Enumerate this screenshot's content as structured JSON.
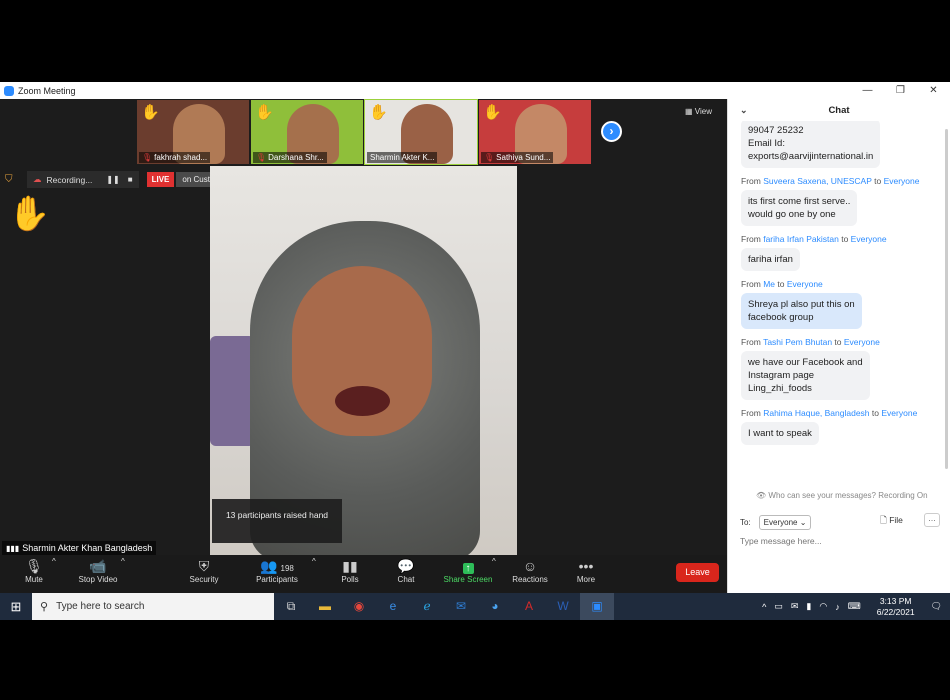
{
  "window": {
    "title": "Zoom Meeting",
    "controls": [
      "—",
      "❐",
      "✕"
    ]
  },
  "participants_strip": [
    {
      "name": "fakhrah shad...",
      "bg": "#6b3d2e",
      "face": "#b07a55",
      "hand": true,
      "muted": true
    },
    {
      "name": "Darshana Shr...",
      "bg": "#8fbf3a",
      "face": "#a5704c",
      "hand": true,
      "muted": true
    },
    {
      "name": "Sharmin Akter K...",
      "bg": "#e6e4e0",
      "face": "#9a6146",
      "hand": true,
      "muted": false
    },
    {
      "name": "Sathiya Sund...",
      "bg": "#c63d3d",
      "face": "#c48866",
      "hand": true,
      "muted": true
    }
  ],
  "view_label": "View",
  "recording": {
    "label": "Recording...",
    "live": "LIVE",
    "stream": "on Custom Live Streaming Service"
  },
  "raised_toast": "13 participants raised hand",
  "speaker_name": "Sharmin Akter Khan Bangladesh",
  "toolbar": {
    "mute": "Mute",
    "stop_video": "Stop Video",
    "security": "Security",
    "participants": "Participants",
    "participants_count": "198",
    "polls": "Polls",
    "chat": "Chat",
    "share_screen": "Share Screen",
    "reactions": "Reactions",
    "more": "More",
    "leave": "Leave"
  },
  "chat": {
    "title": "Chat",
    "messages": [
      {
        "from": "",
        "to": "",
        "text": "99047 25232\nEmail Id:\nexports@aarvijinternational.in",
        "me": false
      },
      {
        "from": "Suveera Saxena, UNESCAP",
        "to": "Everyone",
        "text": "its first come first serve..\nwould go one by one",
        "me": false
      },
      {
        "from": "fariha Irfan Pakistan",
        "to": "Everyone",
        "text": "fariha irfan",
        "me": false
      },
      {
        "from": "Me",
        "to": "Everyone",
        "text": "Shreya pl also put this on\nfacebook group",
        "me": true
      },
      {
        "from": "Tashi Pem Bhutan",
        "to": "Everyone",
        "text": "we have our Facebook and\nInstagram page\nLing_zhi_foods",
        "me": false
      },
      {
        "from": "Rahima Haque, Bangladesh",
        "to": "Everyone",
        "text": "I want to speak",
        "me": false
      }
    ],
    "from_prefix": "From",
    "to_word": "to",
    "notice": "Who can see your messages? Recording On",
    "to_label": "To:",
    "to_value": "Everyone",
    "file_label": "File",
    "input_placeholder": "Type message here..."
  },
  "taskbar": {
    "search_placeholder": "Type here to search",
    "time": "3:13 PM",
    "date": "6/22/2021"
  }
}
